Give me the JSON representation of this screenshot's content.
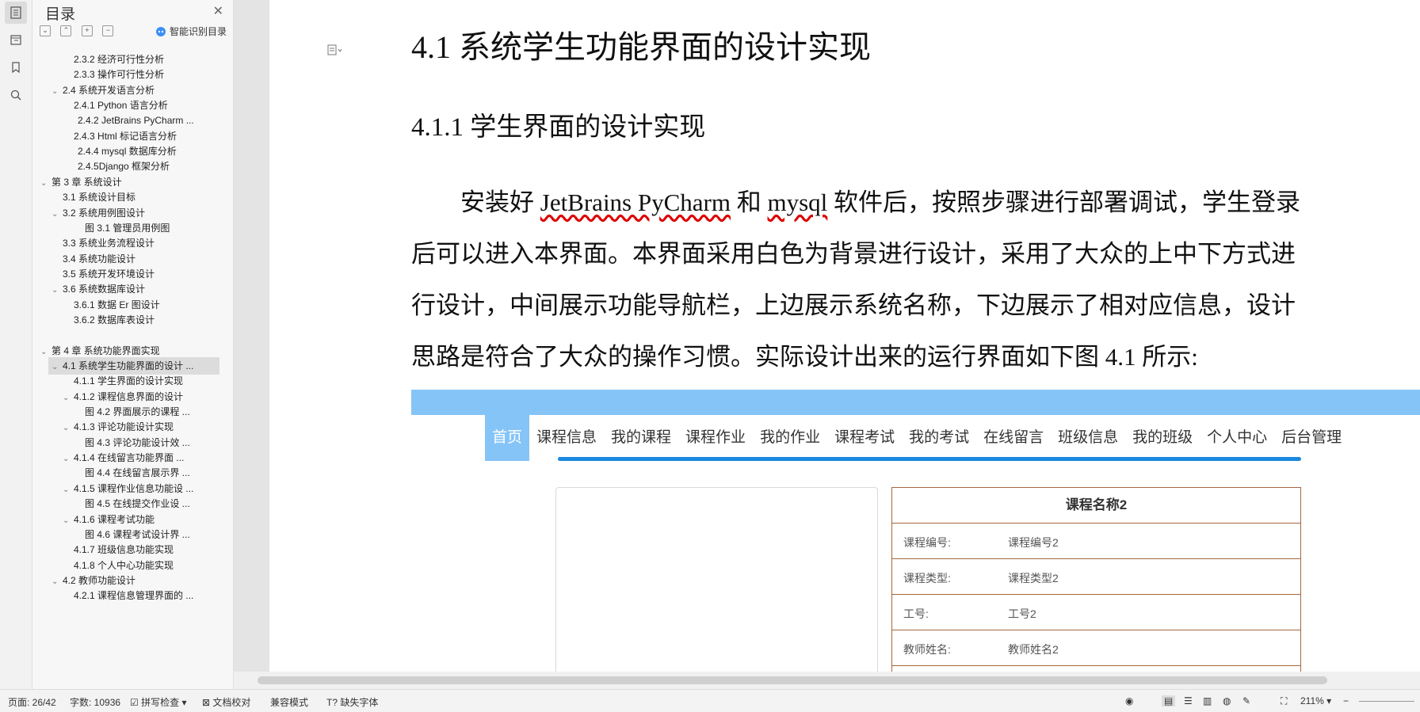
{
  "toc": {
    "title": "目录",
    "smart_label": "智能识别目录",
    "items": [
      {
        "text": "2.3.2 经济可行性分析",
        "lvl": 3,
        "tog": ""
      },
      {
        "text": "2.3.3 操作可行性分析",
        "lvl": 3,
        "tog": ""
      },
      {
        "text": "2.4 系统开发语言分析",
        "lvl": 2,
        "tog": "v"
      },
      {
        "text": "2.4.1 Python 语言分析",
        "lvl": 3,
        "tog": ""
      },
      {
        "text": "2.4.2 JetBrains PyCharm ...",
        "lvl": 3.4,
        "tog": ""
      },
      {
        "text": "2.4.3 Html 标记语言分析",
        "lvl": 3,
        "tog": ""
      },
      {
        "text": "2.4.4 mysql 数据库分析",
        "lvl": 3.4,
        "tog": ""
      },
      {
        "text": "2.4.5Django 框架分析",
        "lvl": 3.4,
        "tog": ""
      },
      {
        "text": "第 3 章 系统设计",
        "lvl": 1,
        "tog": "v"
      },
      {
        "text": "3.1 系统设计目标",
        "lvl": 2,
        "tog": ""
      },
      {
        "text": "3.2 系统用例图设计",
        "lvl": 2,
        "tog": "v"
      },
      {
        "text": "图 3.1 管理员用例图",
        "lvl": 4,
        "tog": ""
      },
      {
        "text": "3.3 系统业务流程设计",
        "lvl": 2,
        "tog": ""
      },
      {
        "text": "3.4 系统功能设计",
        "lvl": 2,
        "tog": ""
      },
      {
        "text": "3.5 系统开发环境设计",
        "lvl": 2,
        "tog": ""
      },
      {
        "text": "3.6 系统数据库设计",
        "lvl": 2,
        "tog": "v"
      },
      {
        "text": "3.6.1 数据 Er 图设计",
        "lvl": 3,
        "tog": ""
      },
      {
        "text": "3.6.2 数据库表设计",
        "lvl": 3,
        "tog": ""
      },
      {
        "text": "",
        "lvl": 3,
        "tog": ""
      },
      {
        "text": "第 4 章 系统功能界面实现",
        "lvl": 1,
        "tog": "v"
      },
      {
        "text": "4.1 系统学生功能界面的设计 ...",
        "lvl": 2,
        "tog": "v",
        "sel": true
      },
      {
        "text": "4.1.1 学生界面的设计实现",
        "lvl": 3,
        "tog": ""
      },
      {
        "text": "4.1.2 课程信息界面的设计",
        "lvl": 3,
        "tog": "v"
      },
      {
        "text": "图 4.2 界面展示的课程 ...",
        "lvl": 4,
        "tog": ""
      },
      {
        "text": "4.1.3 评论功能设计实现",
        "lvl": 3,
        "tog": "v"
      },
      {
        "text": "图 4.3 评论功能设计效 ...",
        "lvl": 4,
        "tog": ""
      },
      {
        "text": "4.1.4 在线留言功能界面 ...",
        "lvl": 3,
        "tog": "v"
      },
      {
        "text": "图 4.4 在线留言展示界 ...",
        "lvl": 4,
        "tog": ""
      },
      {
        "text": "4.1.5 课程作业信息功能设 ...",
        "lvl": 3,
        "tog": "v"
      },
      {
        "text": "图 4.5 在线提交作业设 ...",
        "lvl": 4,
        "tog": ""
      },
      {
        "text": "4.1.6 课程考试功能",
        "lvl": 3,
        "tog": "v"
      },
      {
        "text": "图 4.6 课程考试设计界 ...",
        "lvl": 4,
        "tog": ""
      },
      {
        "text": "4.1.7 班级信息功能实现",
        "lvl": 3,
        "tog": ""
      },
      {
        "text": "4.1.8 个人中心功能实现",
        "lvl": 3,
        "tog": ""
      },
      {
        "text": "4.2 教师功能设计",
        "lvl": 2,
        "tog": "v"
      },
      {
        "text": "4.2.1 课程信息管理界面的 ...",
        "lvl": 3,
        "tog": ""
      }
    ]
  },
  "doc": {
    "h1": "4.1 系统学生功能界面的设计实现",
    "h2": "4.1.1 学生界面的设计实现",
    "para": {
      "l1a": "安装好 ",
      "l1b": "JetBrains PyCharm",
      "l1c": " 和 ",
      "l1d": "mysql",
      "l1e": " 软件后，按照步骤进行部署调试，学生登录",
      "l2": "后可以进入本界面。本界面采用白色为背景进行设计，采用了大众的上中下方式进",
      "l3": "行设计，中间展示功能导航栏，上边展示系统名称，下边展示了相对应信息，设计",
      "l4": "思路是符合了大众的操作习惯。实际设计出来的运行界面如下图 4.1 所示:"
    }
  },
  "shot": {
    "nav": [
      "首页",
      "课程信息",
      "我的课程",
      "课程作业",
      "我的作业",
      "课程考试",
      "我的考试",
      "在线留言",
      "班级信息",
      "我的班级",
      "个人中心",
      "后台管理"
    ],
    "info_title": "课程名称2",
    "rows": [
      {
        "k": "课程编号:",
        "v": "课程编号2"
      },
      {
        "k": "课程类型:",
        "v": "课程类型2"
      },
      {
        "k": "工号:",
        "v": "工号2"
      },
      {
        "k": "教师姓名:",
        "v": "教师姓名2"
      }
    ]
  },
  "status": {
    "page": "页面: 26/42",
    "words": "字数: 10936",
    "spell": "拼写检查",
    "proof": "文档校对",
    "compat": "兼容模式",
    "font": "缺失字体",
    "zoom": "211%"
  },
  "colors": {
    "accent": "#85c4f7",
    "nav_bar": "#1a88e0",
    "info_border": "#a5673f"
  }
}
